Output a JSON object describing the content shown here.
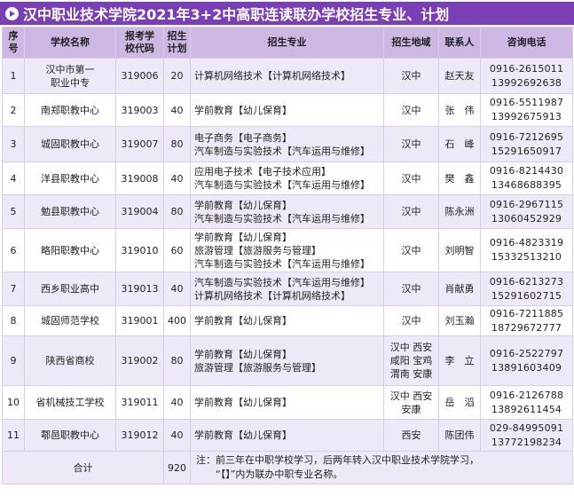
{
  "title": "汉中职业技术学院2021年3+2中高职连读联办学校招生专业、计划",
  "headers": {
    "no": [
      "序",
      "号"
    ],
    "school": "学校名称",
    "code": [
      "报考学",
      "校代码"
    ],
    "plan": [
      "招生",
      "计划"
    ],
    "major": "招生专业",
    "region": "招生地域",
    "contact": "联系人",
    "phone": "咨询电话"
  },
  "rows": [
    {
      "no": "1",
      "school": [
        "汉中市第一",
        "职业中专"
      ],
      "code": "319006",
      "plan": "20",
      "majors": [
        "计算机网络技术【计算机网络技术】"
      ],
      "region": [
        "汉中"
      ],
      "contact": "赵天友",
      "phones": [
        "0916-2615011",
        "13992692638"
      ]
    },
    {
      "no": "2",
      "school": [
        "南郑职教中心"
      ],
      "code": "319003",
      "plan": "40",
      "majors": [
        "学前教育【幼儿保育】"
      ],
      "region": [
        "汉中"
      ],
      "contact": "张　伟",
      "phones": [
        "0916-5511987",
        "13992675913"
      ]
    },
    {
      "no": "3",
      "school": [
        "城固职教中心"
      ],
      "code": "319007",
      "plan": "80",
      "majors": [
        "电子商务【电子商务】",
        "汽车制造与实验技术【汽车运用与维修】"
      ],
      "region": [
        "汉中"
      ],
      "contact": "石　峰",
      "phones": [
        "0916-7212695",
        "15291650917"
      ]
    },
    {
      "no": "4",
      "school": [
        "洋县职教中心"
      ],
      "code": "319008",
      "plan": "40",
      "majors": [
        "应用电子技术【电子技术应用】",
        "汽车制造与实验技术【汽车运用与维修】"
      ],
      "region": [
        "汉中"
      ],
      "contact": "樊　鑫",
      "phones": [
        "0916-8214430",
        "13468688395"
      ]
    },
    {
      "no": "5",
      "school": [
        "勉县职教中心"
      ],
      "code": "319004",
      "plan": "80",
      "majors": [
        "学前教育【幼儿保育】",
        "汽车制造与实验技术【汽车运用与维修】"
      ],
      "region": [
        "汉中"
      ],
      "contact": "陈永洲",
      "phones": [
        "0916-2967115",
        "13060452929"
      ]
    },
    {
      "no": "6",
      "school": [
        "略阳职教中心"
      ],
      "code": "319010",
      "plan": "60",
      "majors": [
        "学前教育【幼儿保育】",
        "旅游管理【旅游服务与管理】",
        "汽车制造与实验技术【汽车运用与维修】"
      ],
      "region": [
        "汉中"
      ],
      "contact": "刘明智",
      "phones": [
        "0916-4823319",
        "15332513210"
      ]
    },
    {
      "no": "7",
      "school": [
        "西乡职业高中"
      ],
      "code": "319013",
      "plan": "40",
      "majors": [
        "汽车制造与实验技术【汽车运用与维修】",
        "计算机网络技术【计算机网络技术】"
      ],
      "region": [
        "汉中"
      ],
      "contact": "肖献勇",
      "phones": [
        "0916-6213273",
        "15291602715"
      ]
    },
    {
      "no": "8",
      "school": [
        "城固师范学校"
      ],
      "code": "319001",
      "plan": "400",
      "majors": [
        "学前教育【幼儿保育】"
      ],
      "region": [
        "汉中"
      ],
      "contact": "刘玉瀚",
      "phones": [
        "0916-7211885",
        "18729672777"
      ]
    },
    {
      "no": "9",
      "school": [
        "陕西省商校"
      ],
      "code": "319002",
      "plan": "80",
      "majors": [
        "学前教育【幼儿保育】",
        "旅游管理【旅游服务与管理】"
      ],
      "region": [
        "汉中 西安",
        "咸阳 宝鸡",
        "渭南 安康"
      ],
      "contact": "李　立",
      "phones": [
        "0916-2522797",
        "13891603409"
      ]
    },
    {
      "no": "10",
      "school": [
        "省机械技工学校"
      ],
      "code": "319011",
      "plan": "40",
      "majors": [
        "学前教育【幼儿保育】"
      ],
      "region": [
        "汉中 西安",
        "安康"
      ],
      "contact": "岳　滔",
      "phones": [
        "0916-2126788",
        "13892611454"
      ]
    },
    {
      "no": "11",
      "school": [
        "鄠邑职教中心"
      ],
      "code": "319012",
      "plan": "40",
      "majors": [
        "学前教育【幼儿保育】"
      ],
      "region": [
        "西安"
      ],
      "contact": "陈团伟",
      "phones": [
        "029-84995091",
        "13772198234"
      ]
    }
  ],
  "footer": {
    "label": "合计",
    "total": "920",
    "note": [
      "注：前三年在中职学校学习，后两年转入汉中职业技术学院学习，",
      "　　“【】”内为联办中职专业名称。"
    ]
  },
  "colors": {
    "title_bg": "#7b3fb5",
    "header_bg": "#cdb8e3",
    "row_alt": "#efe8f6"
  },
  "icons": {
    "title": "play-circle-icon"
  }
}
